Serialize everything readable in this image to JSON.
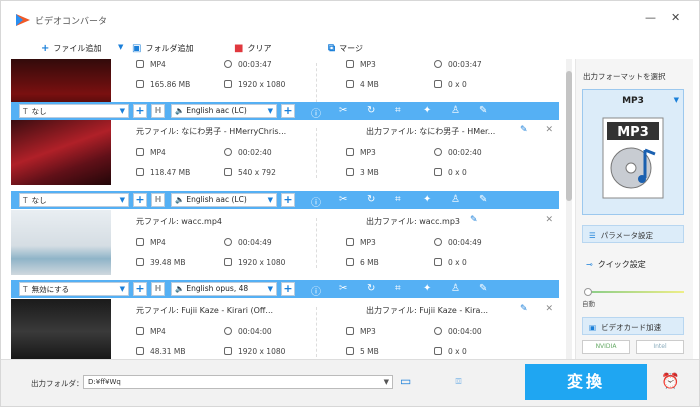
{
  "app": {
    "title": "ビデオコンバータ"
  },
  "toolbar": {
    "add_file": "ファイル追加",
    "add_folder": "フォルダ追加",
    "clear": "クリア",
    "merge": "マージ"
  },
  "items": [
    {
      "src": {
        "name": "",
        "format": "MP4",
        "duration": "00:03:47",
        "size": "165.86 MB",
        "resolution": "1920 x 1080"
      },
      "out": {
        "name": "",
        "format": "MP3",
        "duration": "00:03:47",
        "size": "4 MB",
        "resolution": "0 x 0"
      }
    },
    {
      "src": {
        "name": "元ファイル: なにわ男子 - HMerryChris...",
        "format": "MP4",
        "duration": "00:02:40",
        "size": "118.47 MB",
        "resolution": "540 x 792"
      },
      "out": {
        "name": "出力ファイル: なにわ男子 - HMer...",
        "format": "MP3",
        "duration": "00:02:40",
        "size": "3 MB",
        "resolution": "0 x 0"
      }
    },
    {
      "src": {
        "name": "元ファイル: wacc.mp4",
        "format": "MP4",
        "duration": "00:04:49",
        "size": "39.48 MB",
        "resolution": "1920 x 1080"
      },
      "out": {
        "name": "出力ファイル: wacc.mp3",
        "format": "MP3",
        "duration": "00:04:49",
        "size": "6 MB",
        "resolution": "0 x 0"
      }
    },
    {
      "src": {
        "name": "元ファイル: Fujii Kaze - Kirari (Off...",
        "format": "MP4",
        "duration": "00:04:00",
        "size": "48.31 MB",
        "resolution": "1920 x 1080"
      },
      "out": {
        "name": "出力ファイル: Fujii Kaze - Kira...",
        "format": "MP3",
        "duration": "00:04:00",
        "size": "5 MB",
        "resolution": "0 x 0"
      }
    }
  ],
  "option_rows": [
    {
      "subtitle": "なし",
      "audio": "English aac (LC)"
    },
    {
      "subtitle": "なし",
      "audio": "English aac (LC)"
    },
    {
      "subtitle": "無効にする",
      "audio": "English opus, 48"
    }
  ],
  "right_panel": {
    "format_title": "出力フォーマットを選択",
    "format": "MP3",
    "param_settings": "パラメータ設定",
    "quick_settings": "クイック設定",
    "auto_label": "自動",
    "gpu_accel": "ビデオカード加速",
    "nvidia": "NVIDIA",
    "intel": "Intel"
  },
  "bottom": {
    "folder_label": "出力フォルダ：",
    "folder_path": "D:¥ff¥Wq",
    "convert": "変換"
  },
  "colors": {
    "accent": "#1fa6f2",
    "option_bar": "#55b0f4"
  }
}
